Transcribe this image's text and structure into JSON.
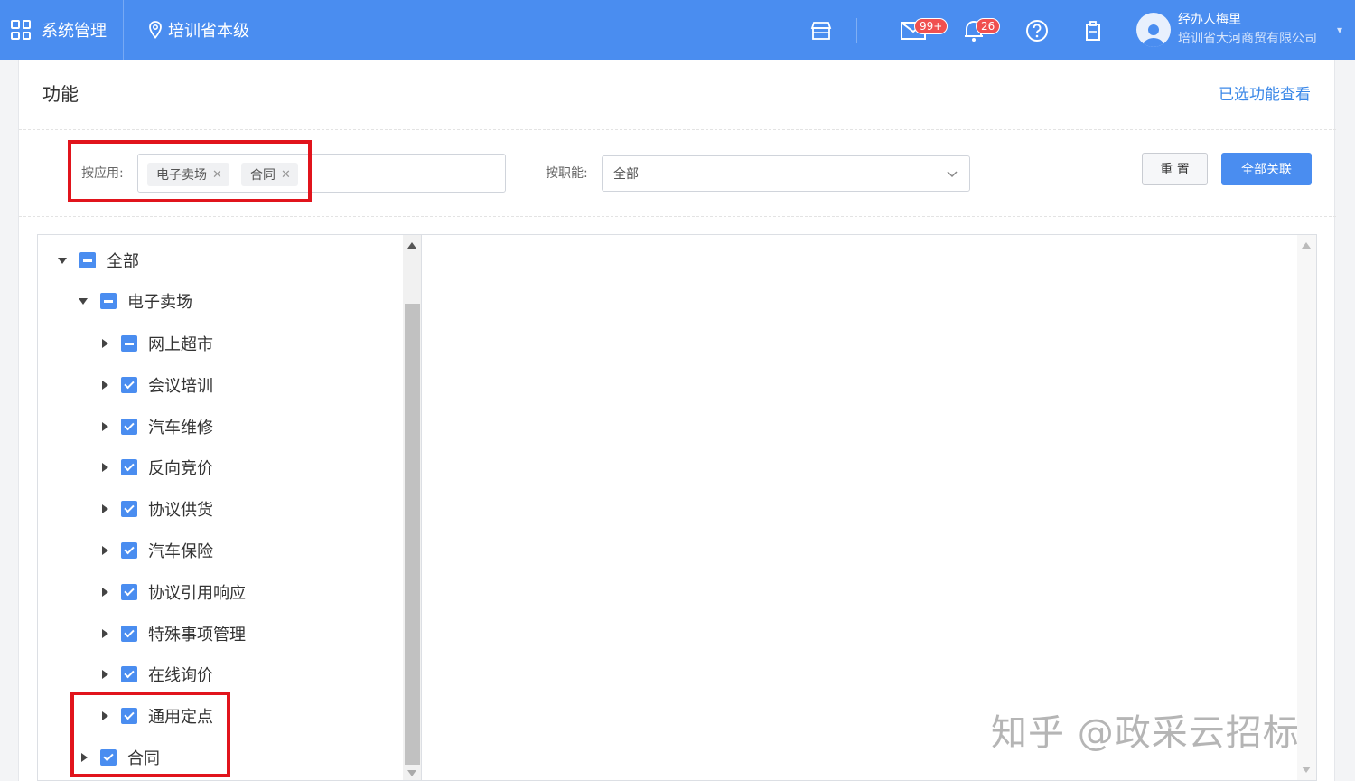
{
  "topbar": {
    "system_label": "系统管理",
    "region_label": "培训省本级",
    "mail_badge": "99+",
    "bell_badge": "26",
    "user_name": "经办人梅里",
    "user_org": "培训省大河商贸有限公司",
    "icons": [
      "grid-icon",
      "location-icon",
      "store-icon",
      "mail-icon",
      "bell-icon",
      "help-icon",
      "clipboard-icon",
      "user-icon"
    ]
  },
  "panel": {
    "title": "功能",
    "view_link": "已选功能查看"
  },
  "filters": {
    "app_label": "按应用:",
    "app_tags": [
      "电子卖场",
      "合同"
    ],
    "role_label": "按职能:",
    "role_value": "全部",
    "reset_button": "重 置",
    "link_all_button": "全部关联"
  },
  "tree": {
    "nodes": [
      {
        "label": "全部",
        "state": "partial",
        "expanded": true
      },
      {
        "label": "电子卖场",
        "state": "partial",
        "expanded": true
      },
      {
        "label": "网上超市",
        "state": "partial",
        "expanded": false
      },
      {
        "label": "会议培训",
        "state": "checked",
        "expanded": false
      },
      {
        "label": "汽车维修",
        "state": "checked",
        "expanded": false
      },
      {
        "label": "反向竞价",
        "state": "checked",
        "expanded": false
      },
      {
        "label": "协议供货",
        "state": "checked",
        "expanded": false
      },
      {
        "label": "汽车保险",
        "state": "checked",
        "expanded": false
      },
      {
        "label": "协议引用响应",
        "state": "checked",
        "expanded": false
      },
      {
        "label": "特殊事项管理",
        "state": "checked",
        "expanded": false
      },
      {
        "label": "在线询价",
        "state": "checked",
        "expanded": false
      },
      {
        "label": "通用定点",
        "state": "checked",
        "expanded": false
      },
      {
        "label": "合同",
        "state": "checked",
        "expanded": false
      }
    ]
  },
  "watermark": "知乎 @政采云招标",
  "colors": {
    "accent": "#4a8df0",
    "highlight": "#e1141c",
    "link": "#3b88e8"
  }
}
